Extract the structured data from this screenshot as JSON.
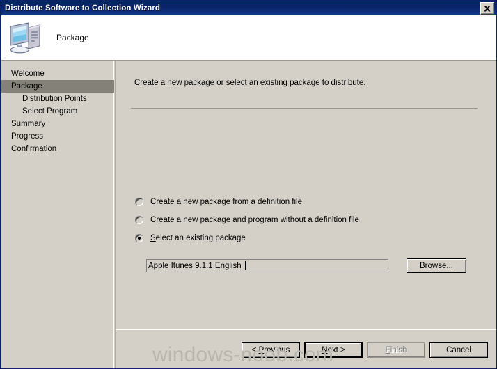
{
  "window": {
    "title": "Distribute Software to Collection Wizard",
    "close_icon": "close-x-icon",
    "titlebar_color": "#0a246a",
    "face_color": "#d4d0c8"
  },
  "header": {
    "title": "Package",
    "icon": "computer-icon"
  },
  "sidebar": {
    "items": [
      {
        "label": "Welcome",
        "indent": false,
        "active": false
      },
      {
        "label": "Package",
        "indent": false,
        "active": true
      },
      {
        "label": "Distribution Points",
        "indent": true,
        "active": false
      },
      {
        "label": "Select Program",
        "indent": true,
        "active": false
      },
      {
        "label": "Summary",
        "indent": false,
        "active": false
      },
      {
        "label": "Progress",
        "indent": false,
        "active": false
      },
      {
        "label": "Confirmation",
        "indent": false,
        "active": false
      }
    ],
    "highlight_color": "#848278"
  },
  "content": {
    "intro": "Create a new package or select an existing package to distribute.",
    "options": [
      {
        "label": "Create a new package from a definition file",
        "accel_prefix": "C",
        "accel_rest": "reate a new package from a definition file",
        "pre": "",
        "checked": false
      },
      {
        "label": "Create a new package and program without a definition file",
        "pre": "C",
        "accel_prefix": "r",
        "accel_rest": "eate a new package and program without a definition file",
        "checked": false
      },
      {
        "label": "Select an existing package",
        "pre": "",
        "accel_prefix": "S",
        "accel_rest": "elect an existing package",
        "checked": true
      }
    ],
    "package_field": {
      "value": "Apple Itunes 9.1.1 English",
      "placeholder": ""
    },
    "browse_button": {
      "pre": "Bro",
      "accel": "w",
      "post": "se..."
    }
  },
  "buttons": {
    "previous": {
      "pre": "< ",
      "accel": "P",
      "post": "revious",
      "disabled": false
    },
    "next": {
      "pre": "",
      "accel": "N",
      "post": "ext >",
      "disabled": false,
      "default": true
    },
    "finish": {
      "pre": "",
      "accel": "F",
      "post": "inish",
      "disabled": true
    },
    "cancel": {
      "pre": "Cancel",
      "accel": "",
      "post": "",
      "disabled": false
    }
  },
  "watermark": {
    "text": "windows-noob.com",
    "color": "#b9b6af"
  }
}
